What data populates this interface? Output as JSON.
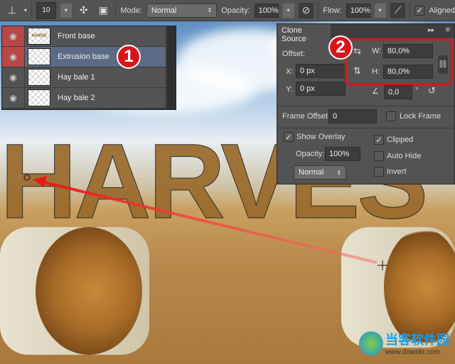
{
  "toolbar": {
    "brush_size": "10",
    "mode_label": "Mode:",
    "mode_value": "Normal",
    "opacity_label": "Opacity:",
    "opacity_value": "100%",
    "flow_label": "Flow:",
    "flow_value": "100%",
    "aligned_label": "Aligned",
    "aligned_checked": true
  },
  "layers": [
    {
      "name": "Front base",
      "thumb_text": "HARVE",
      "visible_highlight": true,
      "selected": false
    },
    {
      "name": "Extrusion base",
      "visible_highlight": true,
      "selected": true
    },
    {
      "name": "Hay bale 1",
      "visible_highlight": false,
      "selected": false
    },
    {
      "name": "Hay bale 2",
      "visible_highlight": false,
      "selected": false
    }
  ],
  "callouts": {
    "one": "1",
    "two": "2"
  },
  "clone_source": {
    "title": "Clone Source",
    "offset_label": "Offset:",
    "x_label": "X:",
    "x_value": "0 px",
    "y_label": "Y:",
    "y_value": "0 px",
    "w_label": "W:",
    "w_value": "80,0%",
    "h_label": "H:",
    "h_value": "80,0%",
    "angle_value": "0,0",
    "degree": "°",
    "frame_offset_label": "Frame Offset:",
    "frame_offset_value": "0",
    "lock_frame_label": "Lock Frame",
    "show_overlay_label": "Show Overlay",
    "overlay_opacity_label": "Opacity:",
    "overlay_opacity_value": "100%",
    "blend_value": "Normal",
    "clipped_label": "Clipped",
    "auto_hide_label": "Auto Hide",
    "invert_label": "Invert"
  },
  "canvas": {
    "letters": "HARVES"
  },
  "watermark": {
    "brand": "当客软件园",
    "url": "www.downkr.com"
  },
  "colors": {
    "accent_red": "#d8141c",
    "panel": "#535353",
    "selected": "#5b6b85"
  }
}
